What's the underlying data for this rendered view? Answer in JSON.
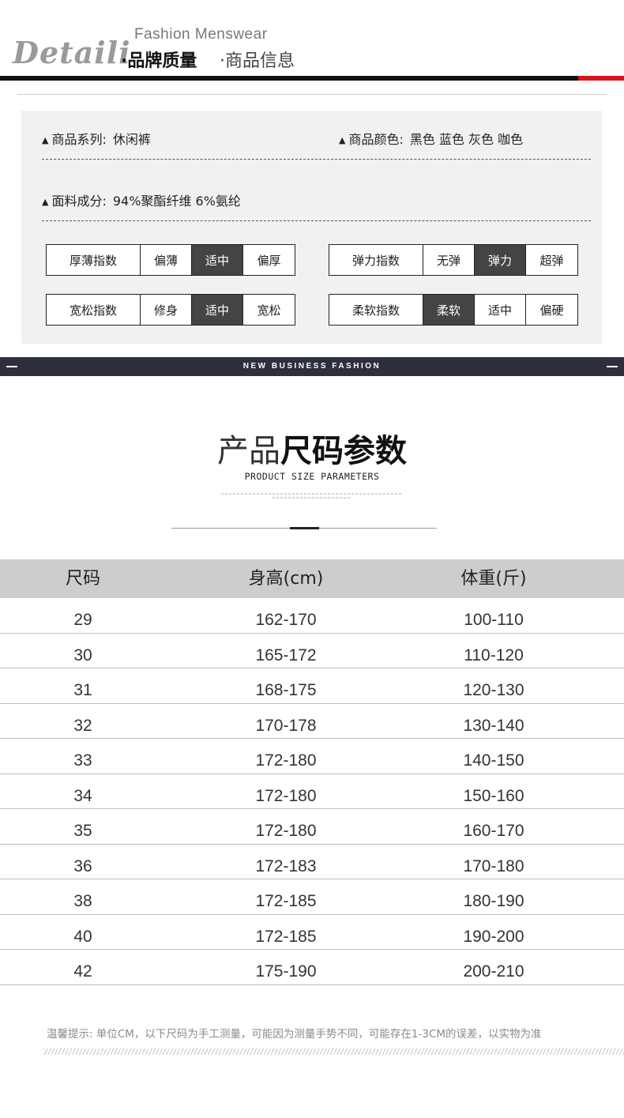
{
  "header": {
    "logo": "Detaili",
    "subtitle": "Fashion Menswear",
    "brand_quality": "·品牌质量",
    "product_info": "·商品信息"
  },
  "attributes": {
    "series": {
      "label": "商品系列:",
      "value": "休闲裤"
    },
    "colors": {
      "label": "商品颜色:",
      "value": "黑色 蓝色 灰色  咖色"
    },
    "fabric": {
      "label": "面料成分:",
      "value": "94%聚酯纤维  6%氨纶"
    }
  },
  "scales": [
    {
      "label": "厚薄指数",
      "options": [
        "偏薄",
        "适中",
        "偏厚"
      ],
      "selected": 1
    },
    {
      "label": "弹力指数",
      "options": [
        "无弹",
        "弹力",
        "超弹"
      ],
      "selected": 1
    },
    {
      "label": "宽松指数",
      "options": [
        "修身",
        "适中",
        "宽松"
      ],
      "selected": 1
    },
    {
      "label": "柔软指数",
      "options": [
        "柔软",
        "适中",
        "偏硬"
      ],
      "selected": 0
    }
  ],
  "banner": {
    "text": "NEW BUSINESS FASHION"
  },
  "size_section": {
    "title_light": "产品",
    "title_bold": "尺码参数",
    "subtitle_en": "PRODUCT SIZE PARAMETERS"
  },
  "size_table": {
    "headers": [
      "尺码",
      "身高(cm)",
      "体重(斤)"
    ],
    "rows": [
      [
        "29",
        "162-170",
        "100-110"
      ],
      [
        "30",
        "165-172",
        "110-120"
      ],
      [
        "31",
        "168-175",
        "120-130"
      ],
      [
        "32",
        "170-178",
        "130-140"
      ],
      [
        "33",
        "172-180",
        "140-150"
      ],
      [
        "34",
        "172-180",
        "150-160"
      ],
      [
        "35",
        "172-180",
        "160-170"
      ],
      [
        "36",
        "172-183",
        "170-180"
      ],
      [
        "38",
        "172-185",
        "180-190"
      ],
      [
        "40",
        "172-185",
        "190-200"
      ],
      [
        "42",
        "175-190",
        "200-210"
      ]
    ]
  },
  "note": "温馨提示: 单位CM，以下尺码为手工测量，可能因为测量手势不同，可能存在1-3CM的误差，以实物为准",
  "colors": {
    "accent_red": "#d9141a",
    "banner_bg": "#2d303c",
    "selected_bg": "#444444"
  }
}
